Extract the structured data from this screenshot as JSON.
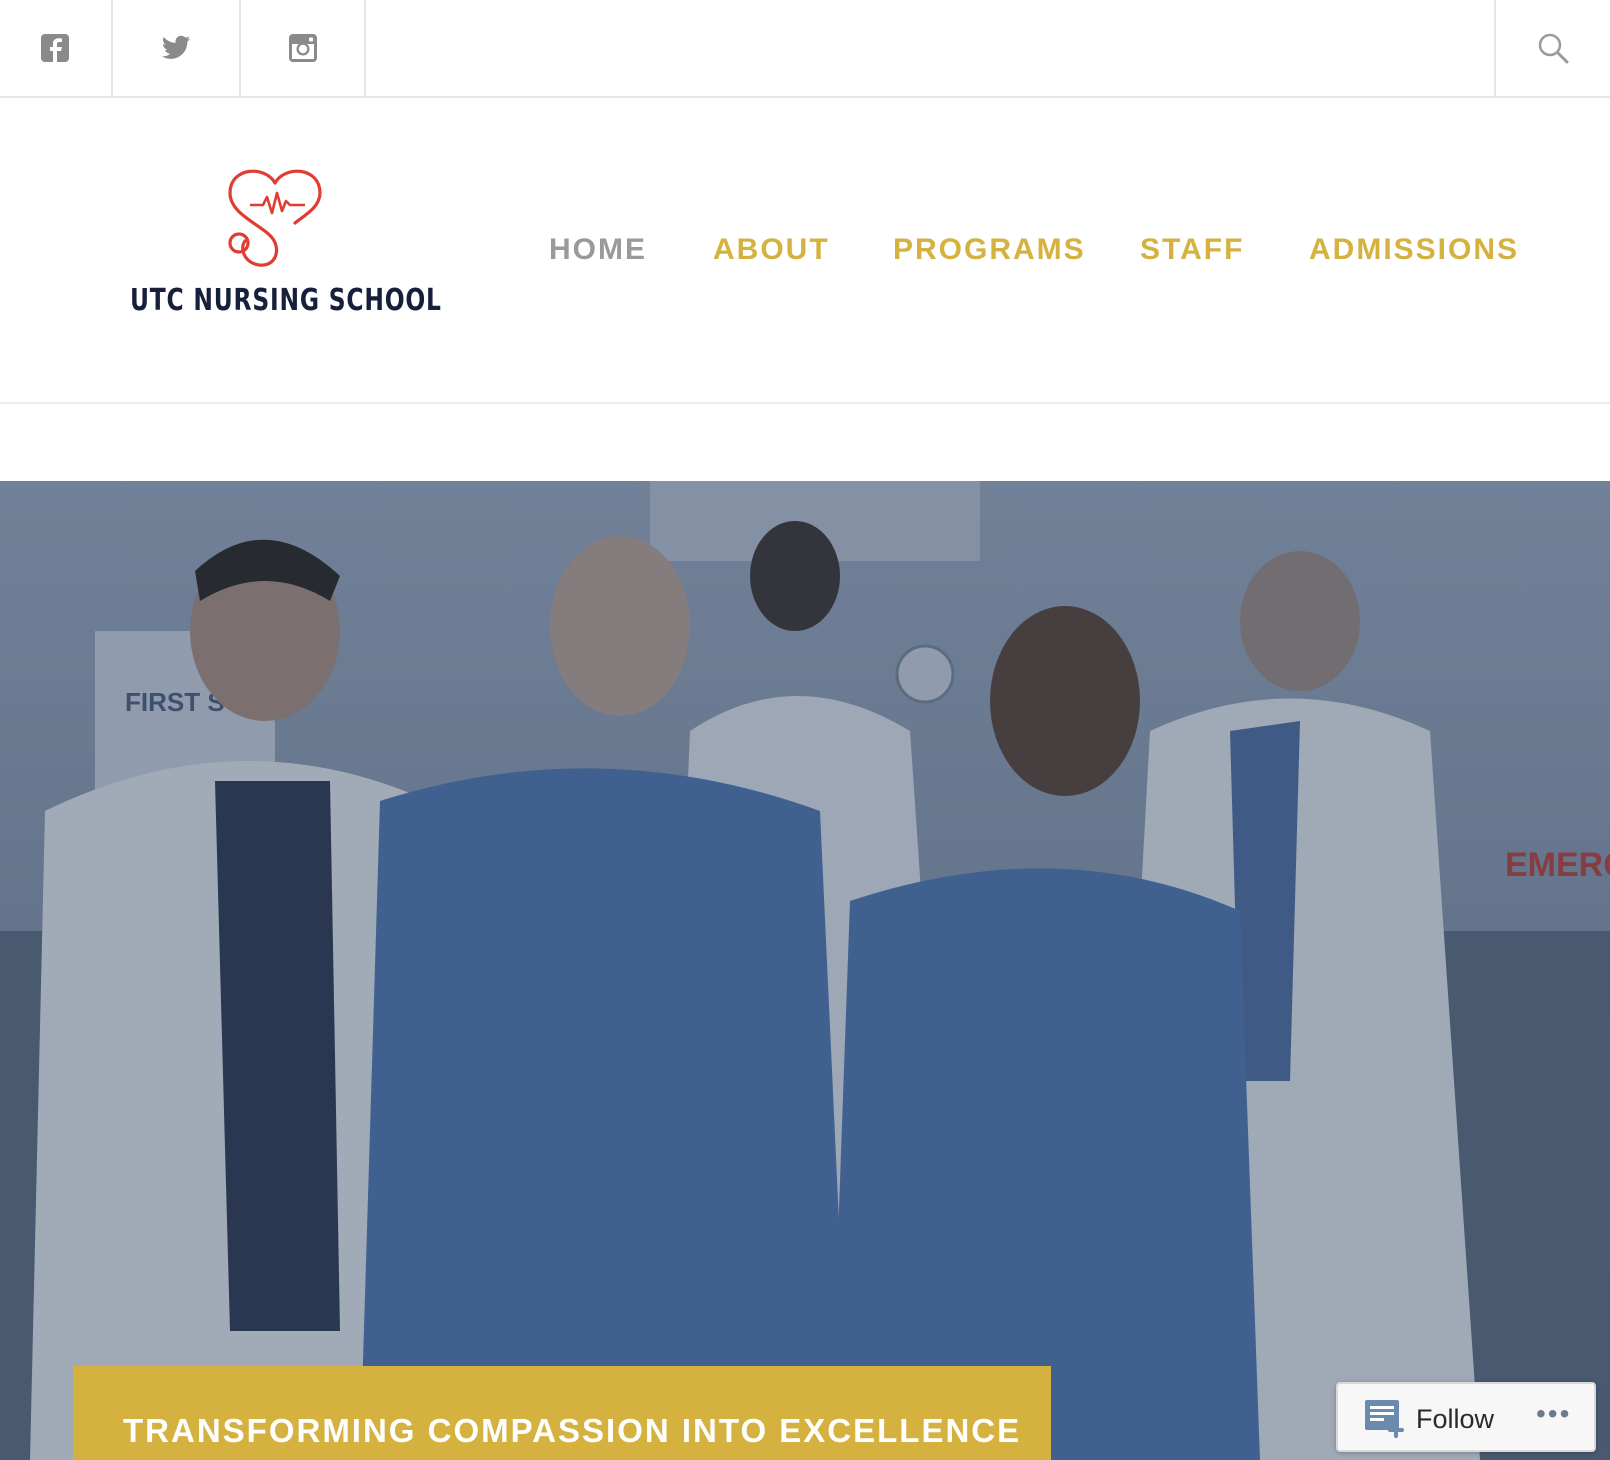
{
  "social": {
    "facebook_icon": "facebook-icon",
    "twitter_icon": "twitter-icon",
    "instagram_icon": "instagram-icon",
    "search_icon": "search-icon"
  },
  "site": {
    "logo_text": "UTC NURSING SCHOOL",
    "logo_color": "#e03c31",
    "text_color": "#16203a"
  },
  "nav": {
    "items": [
      {
        "label": "HOME",
        "active": true
      },
      {
        "label": "ABOUT"
      },
      {
        "label": "PROGRAMS"
      },
      {
        "label": "STAFF"
      },
      {
        "label": "ADMISSIONS"
      }
    ],
    "accent_color": "#d5b13f",
    "active_color": "#9a9a9a"
  },
  "hero": {
    "tagline": "TRANSFORMING COMPASSION INTO EXCELLENCE",
    "wall_sign": "FIRST STAT",
    "emergency_sign": "EMERG"
  },
  "follow": {
    "label": "Follow",
    "more": "•••"
  }
}
